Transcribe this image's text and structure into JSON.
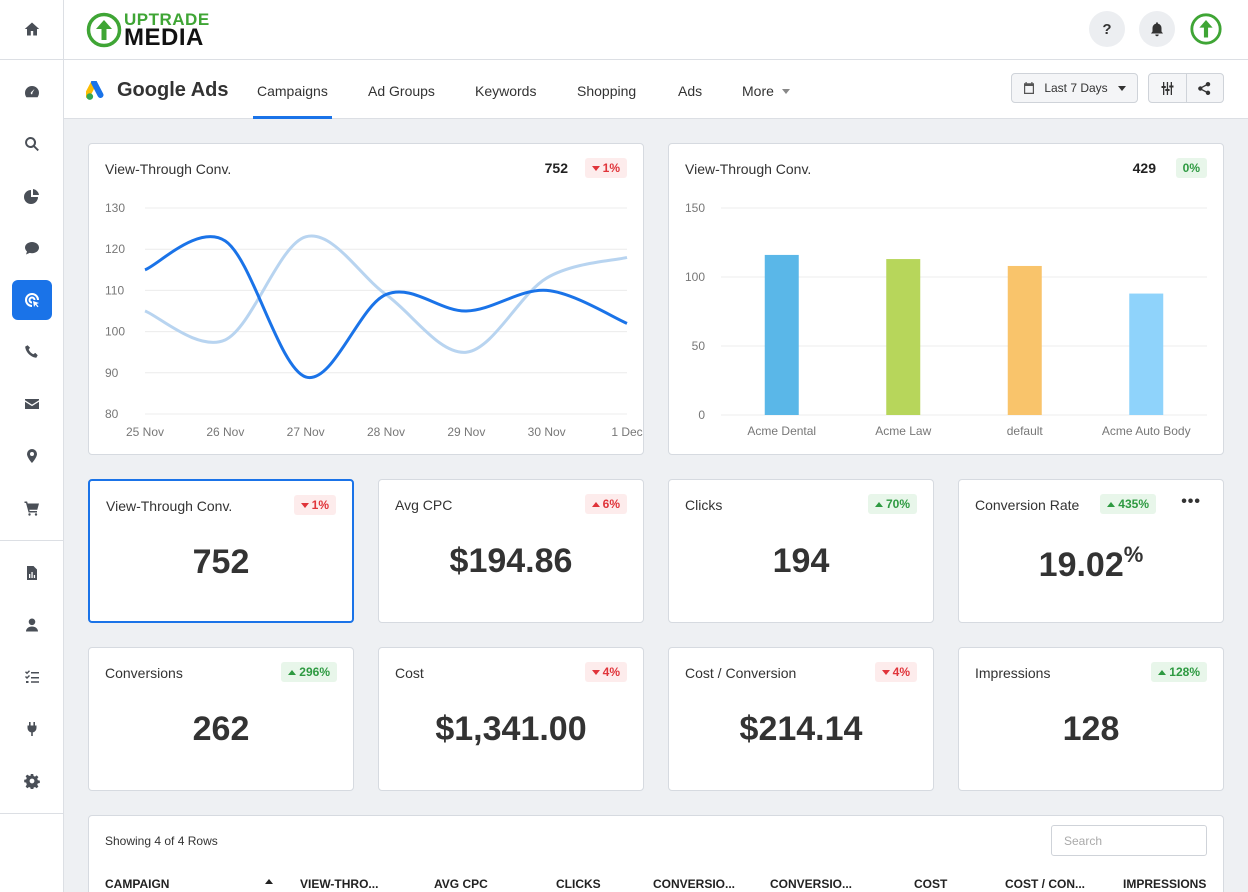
{
  "app": {
    "logo_line1": "UPTRADE",
    "logo_line2": "MEDIA",
    "help_label": "?"
  },
  "nav": {
    "brand": "Google Ads",
    "tabs": [
      "Campaigns",
      "Ad Groups",
      "Keywords",
      "Shopping",
      "Ads",
      "More"
    ],
    "active_tab": "Campaigns",
    "date_range": "Last 7 Days"
  },
  "sidebar": {
    "items": [
      "home-icon",
      "dashboard-icon",
      "search-icon",
      "pie-chart-icon",
      "chat-icon",
      "ads-icon",
      "phone-icon",
      "email-icon",
      "location-icon",
      "cart-icon",
      "report-icon",
      "user-icon",
      "tasks-icon",
      "plug-icon",
      "gear-icon"
    ],
    "active": "ads-icon"
  },
  "colors": {
    "accent": "#1a73e8",
    "line_primary": "#1a73e8",
    "line_secondary": "#b8d4f0",
    "bar_1": "#5ab7e8",
    "bar_2": "#b7d65b",
    "bar_3": "#f9c46b",
    "bar_4": "#8fd3fb",
    "down": "#e0343a",
    "up": "#2e9a41"
  },
  "line_card": {
    "title": "View-Through Conv.",
    "total": "752",
    "badge": "1%",
    "badge_dir": "down"
  },
  "bar_card": {
    "title": "View-Through Conv.",
    "total": "429",
    "badge": "0%",
    "badge_dir": "up"
  },
  "chart_data": [
    {
      "type": "line",
      "title": "View-Through Conv.",
      "x": [
        "25 Nov",
        "26 Nov",
        "27 Nov",
        "28 Nov",
        "29 Nov",
        "30 Nov",
        "1 Dec"
      ],
      "series": [
        {
          "values": [
            115,
            122,
            89,
            109,
            105,
            110,
            102
          ]
        },
        {
          "values": [
            105,
            98,
            123,
            109,
            95,
            113,
            118
          ]
        }
      ],
      "yticks": [
        80,
        90,
        100,
        110,
        120,
        130
      ],
      "ylim": [
        80,
        130
      ],
      "grid": true
    },
    {
      "type": "bar",
      "title": "View-Through Conv.",
      "categories": [
        "Acme Dental",
        "Acme Law",
        "default",
        "Acme Auto Body"
      ],
      "values": [
        116,
        113,
        108,
        88
      ],
      "yticks": [
        0,
        50,
        100,
        150
      ],
      "ylim": [
        0,
        150
      ],
      "grid": true
    }
  ],
  "kpis": [
    {
      "label": "View-Through Conv.",
      "value": "752",
      "suffix": "",
      "change": "1%",
      "dir": "down"
    },
    {
      "label": "Avg CPC",
      "value": "$194.86",
      "suffix": "",
      "change": "6%",
      "dir": "up-red"
    },
    {
      "label": "Clicks",
      "value": "194",
      "suffix": "",
      "change": "70%",
      "dir": "up"
    },
    {
      "label": "Conversion Rate",
      "value": "19.02",
      "suffix": "%",
      "change": "435%",
      "dir": "up"
    },
    {
      "label": "Conversions",
      "value": "262",
      "suffix": "",
      "change": "296%",
      "dir": "up"
    },
    {
      "label": "Cost",
      "value": "$1,341.00",
      "suffix": "",
      "change": "4%",
      "dir": "down"
    },
    {
      "label": "Cost / Conversion",
      "value": "$214.14",
      "suffix": "",
      "change": "4%",
      "dir": "down"
    },
    {
      "label": "Impressions",
      "value": "128",
      "suffix": "",
      "change": "128%",
      "dir": "up"
    }
  ],
  "kpi_menu": "•••",
  "table": {
    "showing": "Showing 4 of 4 Rows",
    "search_placeholder": "Search",
    "columns": [
      "CAMPAIGN",
      "VIEW-THRO...",
      "AVG CPC",
      "CLICKS",
      "CONVERSIO...",
      "CONVERSIO...",
      "COST",
      "COST / CON...",
      "IMPRESSIONS"
    ]
  }
}
